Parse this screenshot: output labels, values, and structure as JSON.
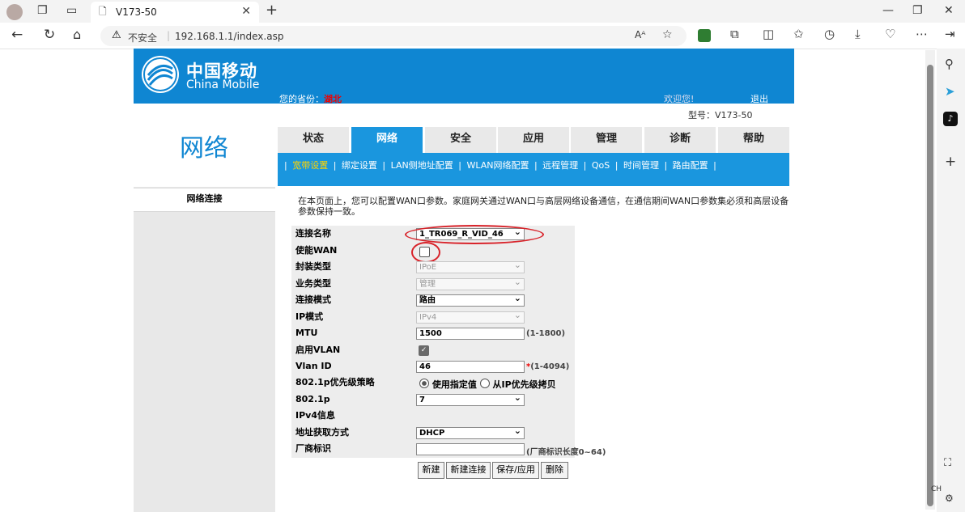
{
  "browser": {
    "tab_title": "V173-50",
    "security_label": "不安全",
    "url": "192.168.1.1/index.asp",
    "ime": "CH"
  },
  "header": {
    "logo_cn": "中国移动",
    "logo_en": "China Mobile",
    "province_label": "您的省份：",
    "province": "湖北",
    "welcome": "欢迎您!",
    "logout": "退出",
    "model": "型号：V173-50"
  },
  "sidebar": {
    "title": "网络",
    "items": [
      {
        "label": "网络连接"
      }
    ]
  },
  "tabs": [
    {
      "label": "状态"
    },
    {
      "label": "网络"
    },
    {
      "label": "安全"
    },
    {
      "label": "应用"
    },
    {
      "label": "管理"
    },
    {
      "label": "诊断"
    },
    {
      "label": "帮助"
    }
  ],
  "subnav": [
    {
      "label": "宽带设置"
    },
    {
      "label": "绑定设置"
    },
    {
      "label": "LAN侧地址配置"
    },
    {
      "label": "WLAN网络配置"
    },
    {
      "label": "远程管理"
    },
    {
      "label": "QoS"
    },
    {
      "label": "时间管理"
    },
    {
      "label": "路由配置"
    }
  ],
  "description": "在本页面上，您可以配置WAN口参数。家庭网关通过WAN口与高层网络设备通信，在通信期间WAN口参数集必须和高层设备参数保持一致。",
  "form": {
    "conn_name": {
      "label": "连接名称",
      "value": "1_TR069_R_VID_46"
    },
    "enable_wan": {
      "label": "使能WAN",
      "checked": false
    },
    "encap": {
      "label": "封装类型",
      "value": "IPoE"
    },
    "service": {
      "label": "业务类型",
      "value": "管理"
    },
    "mode": {
      "label": "连接模式",
      "value": "路由"
    },
    "ipmode": {
      "label": "IP模式",
      "value": "IPv4"
    },
    "mtu": {
      "label": "MTU",
      "value": "1500",
      "hint": "(1-1800)"
    },
    "vlan": {
      "label": "启用VLAN",
      "checked": true
    },
    "vlanid": {
      "label": "Vlan ID",
      "value": "46",
      "hint": "(1-4094)"
    },
    "prio_policy": {
      "label": "802.1p优先级策略",
      "opt1": "使用指定值",
      "opt2": "从IP优先级拷贝"
    },
    "p8021": {
      "label": "802.1p",
      "value": "7"
    },
    "ipv4": {
      "label": "IPv4信息"
    },
    "addr": {
      "label": "地址获取方式",
      "value": "DHCP"
    },
    "vendor": {
      "label": "厂商标识",
      "value": "",
      "hint": "(厂商标识长度0~64)"
    }
  },
  "buttons": {
    "new": "新建",
    "new_conn": "新建连接",
    "save": "保存/应用",
    "delete": "删除"
  }
}
